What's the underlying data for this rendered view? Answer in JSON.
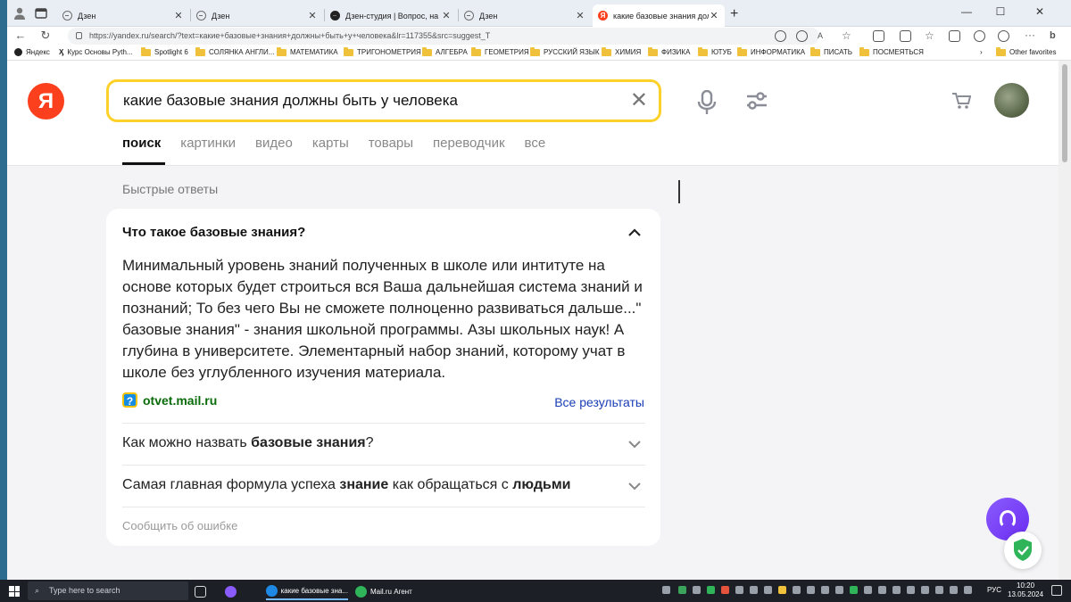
{
  "browser": {
    "tabs": [
      {
        "label": "Дзен",
        "icon": "plus-circle-icon"
      },
      {
        "label": "Дзен",
        "icon": "plus-circle-icon"
      },
      {
        "label": "Дзен-студия | Вопрос, на котор",
        "icon": "plus-circle-icon"
      },
      {
        "label": "Дзен",
        "icon": "plus-circle-icon"
      },
      {
        "label": "какие базовые знания должны",
        "icon": "yandex-icon",
        "active": true
      }
    ],
    "url": "https://yandex.ru/search/?text=какие+базовые+знания+должны+быть+у+человека&lr=117355&src=suggest_T",
    "bookmarks": [
      "Яндекс",
      "Курс Основы Pyth...",
      "Spotlight 6",
      "СОЛЯНКА АНГЛИ...",
      "МАТЕМАТИКА",
      "ТРИГОНОМЕТРИЯ",
      "АЛГЕБРА",
      "ГЕОМЕТРИЯ",
      "РУССКИЙ ЯЗЫК",
      "ХИМИЯ",
      "ФИЗИКА",
      "ЮТУБ",
      "ИНФОРМАТИКА",
      "ПИСАТЬ",
      "ПОСМЕЯТЬСЯ"
    ],
    "other_favorites": "Other favorites"
  },
  "search": {
    "logo": "Я",
    "query": "какие базовые знания должны быть у человека",
    "tabs": [
      "поиск",
      "картинки",
      "видео",
      "карты",
      "товары",
      "переводчик",
      "все"
    ]
  },
  "quick_answers": {
    "title": "Быстрые ответы",
    "expanded": {
      "question": "Что такое базовые знания?",
      "answer": "Минимальный уровень знаний полученных в школе или интитуте на основе которых будет строиться вся Ваша дальнейшая система знаний и познаний; То без чего Вы не сможете полноценно развиваться дальше...\" базовые знания\" - знания школьной программы. Азы школьных наук! А глубина в университете. Элементарный набор знаний, которому учат в школе без углубленного изучения материала.",
      "source": "otvet.mail.ru",
      "all_results": "Все результаты"
    },
    "collapsed": [
      {
        "pre": "Как можно назвать ",
        "bold": "базовые знания",
        "post": "?"
      },
      {
        "pre": "Самая главная формула успеха ",
        "bold": "знание",
        "mid": " как обращаться с ",
        "bold2": "людьми"
      }
    ],
    "report": "Сообщить об ошибке"
  },
  "taskbar": {
    "search_placeholder": "Type here to search",
    "items": [
      "какие базовые зна...",
      "Mail.ru Агент"
    ],
    "lang": "РУС",
    "time": "10:20",
    "date": "13.05.2024"
  }
}
